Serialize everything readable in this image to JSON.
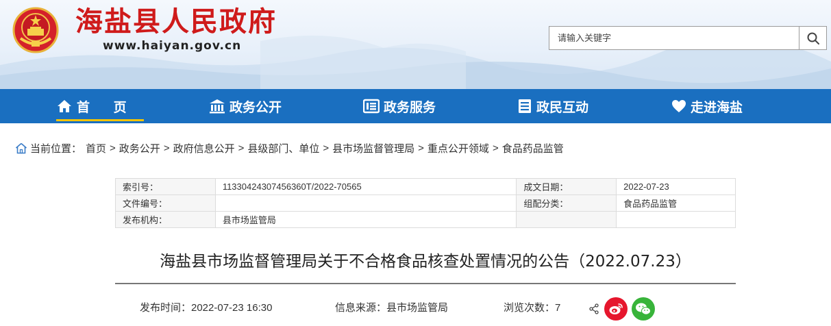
{
  "header": {
    "site_title": "海盐县人民政府",
    "site_url": "www.haiyan.gov.cn",
    "search": {
      "placeholder": "请输入关键字"
    }
  },
  "nav": {
    "items": [
      {
        "label": "首 页",
        "icon": "home-icon"
      },
      {
        "label": "政务公开",
        "icon": "government-building-icon"
      },
      {
        "label": "政务服务",
        "icon": "service-card-icon"
      },
      {
        "label": "政民互动",
        "icon": "document-list-icon"
      },
      {
        "label": "走进海盐",
        "icon": "heart-icon"
      }
    ]
  },
  "breadcrumb": {
    "prefix": "当前位置：",
    "items": [
      "首页",
      "政务公开",
      "政府信息公开",
      "县级部门、单位",
      "县市场监督管理局",
      "重点公开领域",
      "食品药品监管"
    ],
    "separator": ">"
  },
  "info": {
    "index_label": "索引号：",
    "index_value": "11330424307456360T/2022-70565",
    "date_label": "成文日期：",
    "date_value": "2022-07-23",
    "doc_no_label": "文件编号：",
    "doc_no_value": "",
    "category_label": "组配分类：",
    "category_value": "食品药品监管",
    "publisher_label": "发布机构：",
    "publisher_value": "县市场监管局"
  },
  "article": {
    "title": "海盐县市场监督管理局关于不合格食品核查处置情况的公告（2022.07.23）",
    "publish_time": "发布时间：2022-07-23 16:30",
    "source": "信息来源：县市场监管局",
    "views": "浏览次数：7"
  },
  "colors": {
    "title_red": "#cf1b1b",
    "nav_blue": "#1a6fc0",
    "nav_active_underline": "#f5c400",
    "weibo_red": "#e6162d",
    "wechat_green": "#38b43a"
  }
}
